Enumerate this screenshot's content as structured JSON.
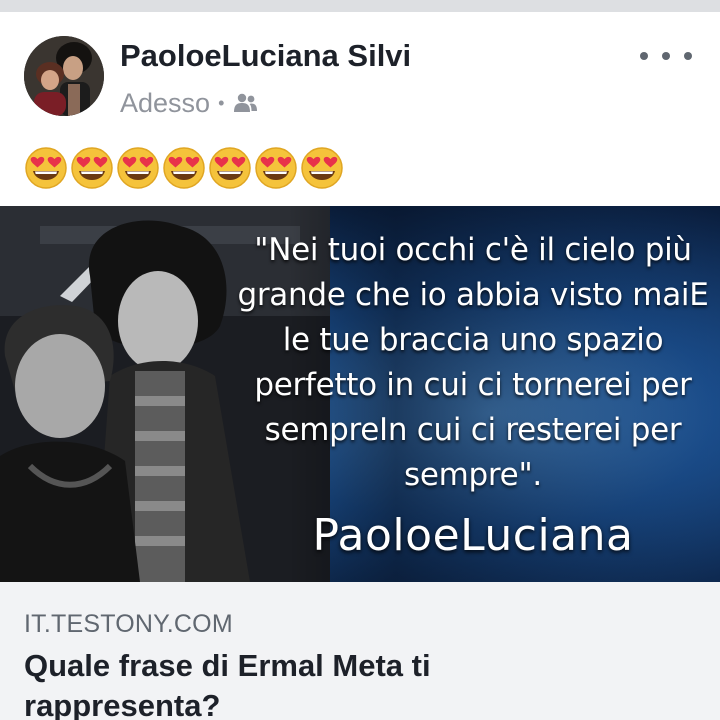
{
  "post": {
    "author": "PaoloeLuciana Silvi",
    "time": "Adesso",
    "separator": "•",
    "audience_icon": "friends-icon",
    "more_icon": "more-options-icon",
    "emoji_text": "😍😍😍😍😍😍😍",
    "emoji_count": 7
  },
  "image": {
    "quote": "\"Nei tuoi occhi c'è il cielo più grande che io abbia visto maiE le tue braccia uno spazio perfetto in cui ci tornerei per sempreIn cui ci resterei per sempre\".",
    "signature": "PaoloeLuciana"
  },
  "link": {
    "domain": "IT.TESTONY.COM",
    "title": "Quale frase di Ermal Meta ti rappresenta?"
  },
  "colors": {
    "page_background": "#e9ebee",
    "card": "#ffffff",
    "link_preview_background": "#f2f3f5",
    "secondary_text": "#90949c",
    "image_background": "#07152e"
  }
}
